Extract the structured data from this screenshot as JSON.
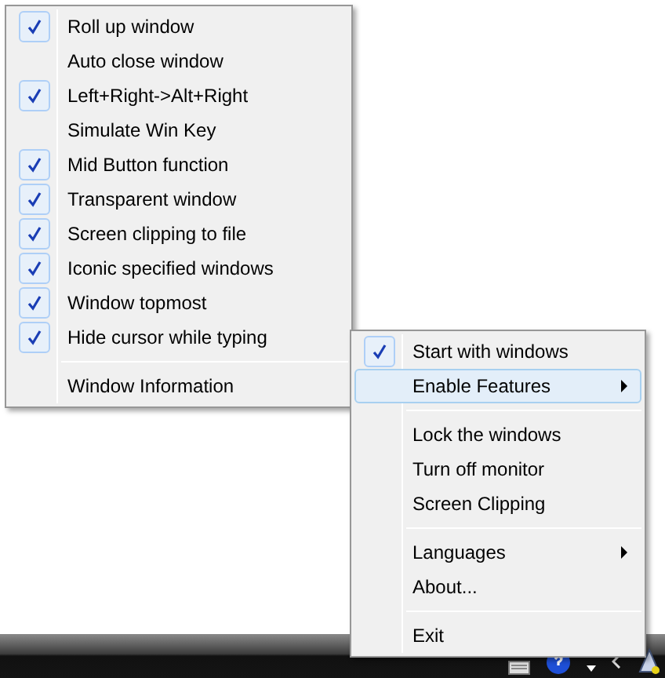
{
  "menus": [
    {
      "sections": [
        [
          {
            "label": "Roll up window",
            "checked": true,
            "selected": false,
            "has_submenu": false
          },
          {
            "label": "Auto close window",
            "checked": false,
            "selected": false,
            "has_submenu": false
          },
          {
            "label": "Left+Right->Alt+Right",
            "checked": true,
            "selected": false,
            "has_submenu": false
          },
          {
            "label": "Simulate Win Key",
            "checked": false,
            "selected": false,
            "has_submenu": false
          },
          {
            "label": "Mid Button function",
            "checked": true,
            "selected": false,
            "has_submenu": false
          },
          {
            "label": "Transparent window",
            "checked": true,
            "selected": false,
            "has_submenu": false
          },
          {
            "label": "Screen clipping to file",
            "checked": true,
            "selected": false,
            "has_submenu": false
          },
          {
            "label": "Iconic specified windows",
            "checked": true,
            "selected": false,
            "has_submenu": false
          },
          {
            "label": "Window topmost",
            "checked": true,
            "selected": false,
            "has_submenu": false
          },
          {
            "label": "Hide cursor while typing",
            "checked": true,
            "selected": false,
            "has_submenu": false
          }
        ],
        [
          {
            "label": "Window Information",
            "checked": false,
            "selected": false,
            "has_submenu": false
          }
        ]
      ]
    },
    {
      "sections": [
        [
          {
            "label": "Start with windows",
            "checked": true,
            "selected": false,
            "has_submenu": false
          },
          {
            "label": "Enable Features",
            "checked": false,
            "selected": true,
            "has_submenu": true
          }
        ],
        [
          {
            "label": "Lock the windows",
            "checked": false,
            "selected": false,
            "has_submenu": false
          },
          {
            "label": "Turn off monitor",
            "checked": false,
            "selected": false,
            "has_submenu": false
          },
          {
            "label": "Screen Clipping",
            "checked": false,
            "selected": false,
            "has_submenu": false
          }
        ],
        [
          {
            "label": "Languages",
            "checked": false,
            "selected": false,
            "has_submenu": true
          },
          {
            "label": "About...",
            "checked": false,
            "selected": false,
            "has_submenu": false
          }
        ],
        [
          {
            "label": "Exit",
            "checked": false,
            "selected": false,
            "has_submenu": false
          }
        ]
      ]
    }
  ]
}
